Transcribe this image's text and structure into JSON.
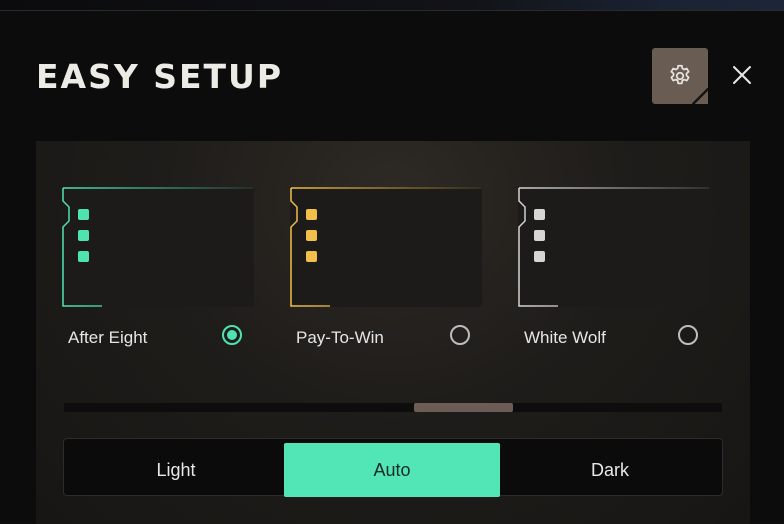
{
  "title": "EASY SETUP",
  "header": {
    "settings_icon": "gear-icon",
    "close_icon": "close-icon"
  },
  "themes": [
    {
      "label": "After Eight",
      "color": "#4fe3b2",
      "selected": true
    },
    {
      "label": "Pay-To-Win",
      "color": "#f2c04a",
      "selected": false
    },
    {
      "label": "White Wolf",
      "color": "#d6d6d6",
      "selected": false
    }
  ],
  "modes": {
    "options": [
      "Light",
      "Auto",
      "Dark"
    ],
    "selected": "Auto",
    "accent": "#52e6b6"
  },
  "colors": {
    "settings_button_bg": "#685c53",
    "scroll_thumb": "#6b5d55"
  }
}
